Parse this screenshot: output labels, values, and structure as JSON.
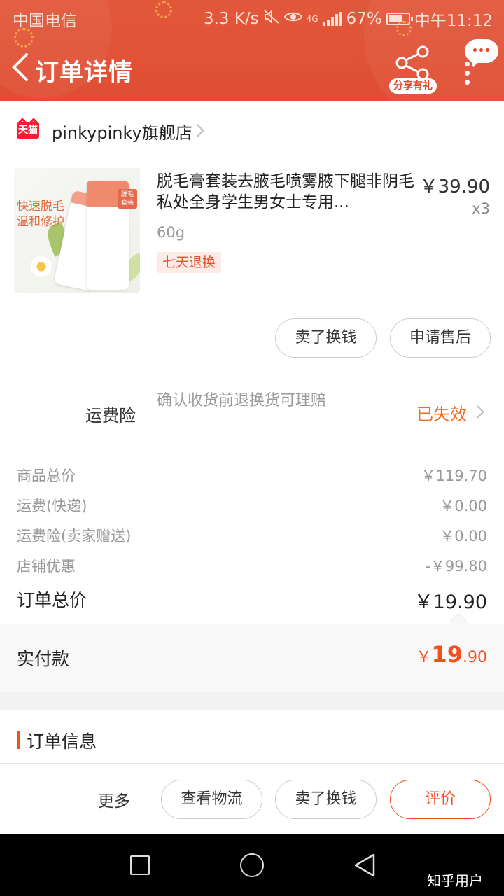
{
  "status_bar": {
    "carrier": "中国电信",
    "speed": "3.3 K/s",
    "network": "4G",
    "battery": "67%",
    "time": "中午11:12"
  },
  "nav": {
    "title": "订单详情",
    "share_label": "分享有礼"
  },
  "shop": {
    "badge": "天猫",
    "name": "pinkypinky旗舰店"
  },
  "product": {
    "image_text": "快速脱毛\n温和修护",
    "image_badge": "脱毛\n套装",
    "name": "脱毛膏套装去腋毛喷雾腋下腿非阴毛私处全身学生男女士专用...",
    "price": "￥39.90",
    "qty": "x3",
    "spec": "60g",
    "service_tag": "七天退换"
  },
  "item_actions": {
    "sell": "卖了换钱",
    "after_sale": "申请售后"
  },
  "insurance": {
    "label": "运费险",
    "desc": "确认收货前退换货可理赔",
    "status": "已失效"
  },
  "price_detail": {
    "rows": [
      {
        "label": "商品总价",
        "value": "￥119.70"
      },
      {
        "label": "运费(快递)",
        "value": "￥0.00"
      },
      {
        "label": "运费险(卖家赠送)",
        "value": "￥0.00"
      },
      {
        "label": "店铺优惠",
        "value": "-￥99.80"
      }
    ],
    "total_label": "订单总价",
    "total_value": "￥19.90",
    "paid_label": "实付款",
    "paid_currency": "￥",
    "paid_int": "19",
    "paid_dec": ".90"
  },
  "order_info": {
    "title": "订单信息"
  },
  "bottom_actions": {
    "more": "更多",
    "logistics": "查看物流",
    "sell": "卖了换钱",
    "review": "评价"
  },
  "watermark": "知乎用户",
  "colors": {
    "header": "#e2573a",
    "accent": "#f2501d",
    "tmall": "#ff1a33",
    "expired": "#f26a1b"
  }
}
